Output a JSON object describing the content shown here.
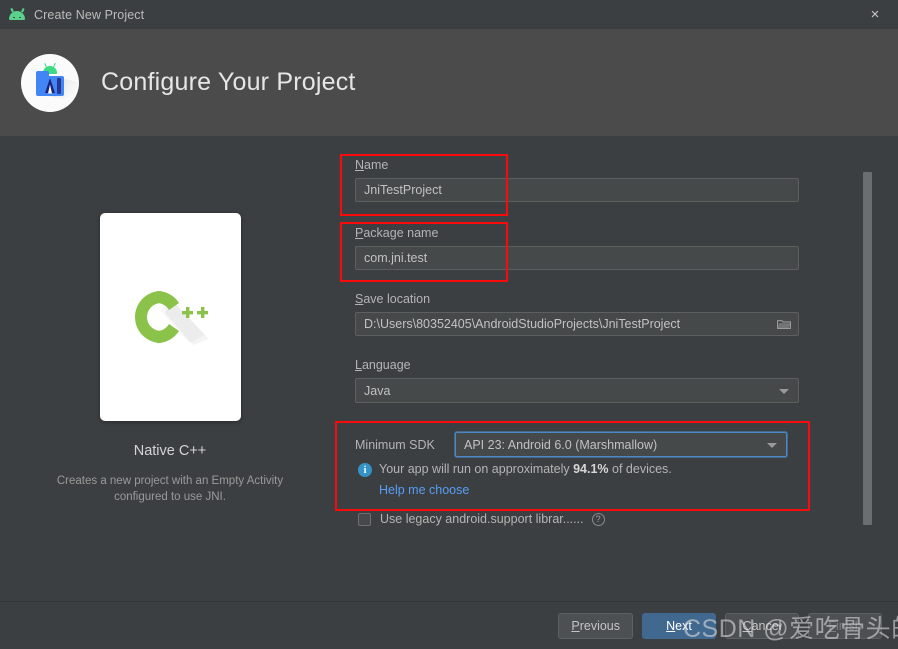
{
  "window": {
    "title": "Create New Project",
    "icon": "android-icon",
    "close_label": "×"
  },
  "header": {
    "title": "Configure Your Project",
    "logo": "android-studio-logo"
  },
  "preview": {
    "template_name": "Native C++",
    "description": "Creates a new project with an Empty Activity configured to use JNI.",
    "logo_text": "C++"
  },
  "form": {
    "name": {
      "label_mnemonic": "N",
      "label_rest": "ame",
      "value": "JniTestProject"
    },
    "package_name": {
      "label_mnemonic": "P",
      "label_rest": "ackage name",
      "value": "com.jni.test"
    },
    "save_location": {
      "label_mnemonic": "S",
      "label_rest": "ave location",
      "value": "D:\\Users\\80352405\\AndroidStudioProjects\\JniTestProject",
      "browse_icon": "folder-icon"
    },
    "language": {
      "label_mnemonic": "L",
      "label_rest": "anguage",
      "value": "Java"
    },
    "minimum_sdk": {
      "label": "Minimum SDK",
      "value": "API 23: Android 6.0 (Marshmallow)",
      "note_prefix": "Your app will run on approximately ",
      "note_percent": "94.1%",
      "note_suffix": " of devices.",
      "help_link": "Help me choose",
      "info_icon": "info-icon",
      "info_glyph": "i"
    },
    "legacy_support": {
      "label": "Use legacy android.support librar......",
      "checked": false,
      "help_icon_glyph": "?"
    }
  },
  "footer": {
    "previous": {
      "mnemonic": "P",
      "rest": "revious"
    },
    "next": {
      "mnemonic": "N",
      "rest": "ext"
    },
    "cancel": {
      "mnemonic": "C",
      "rest": "ancel"
    },
    "finish": {
      "mnemonic": "F",
      "rest": "inish"
    }
  },
  "watermark": {
    "text": "CSDN @爱吃骨头的猫、"
  },
  "colors": {
    "dialog_bg": "#3c3f41",
    "header_bg": "#4b4b4b",
    "accent_blue": "#41688f",
    "link_blue": "#589df6",
    "annotation_red": "#fa0a0a",
    "cpp_green": "#7cb342",
    "android_green": "#3ddc84",
    "info_blue": "#3592c4"
  }
}
